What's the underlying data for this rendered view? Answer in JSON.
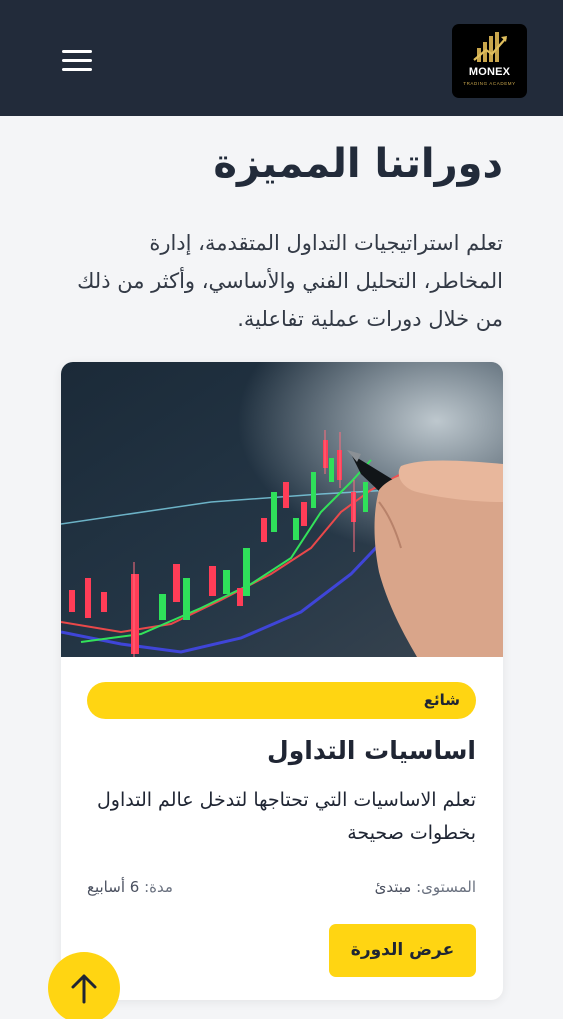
{
  "header": {
    "menu_icon": "hamburger-icon",
    "logo": {
      "name": "MONEX",
      "subtitle": "TRADING ACADEMY"
    }
  },
  "section": {
    "title": "دوراتنا المميزة",
    "description": "تعلم استراتيجيات التداول المتقدمة، إدارة المخاطر، التحليل الفني والأساسي، وأكثر من ذلك من خلال دورات عملية تفاعلية."
  },
  "course": {
    "image": "trading-candlestick-chart-photo",
    "badge": "شائع",
    "title": "اساسيات التداول",
    "description": "تعلم الاساسيات التي تحتاجها لتدخل عالم التداول بخطوات صحيحة",
    "level_label": "المستوى:",
    "level_value": "مبتدئ",
    "duration_label": "مدة:",
    "duration_value": "6 أسابيع",
    "cta": "عرض الدورة"
  },
  "scroll_top_icon": "arrow-up-icon",
  "colors": {
    "header_bg": "#222b3a",
    "accent": "#ffd512",
    "page_bg": "#f4f5f7",
    "text_dark": "#1f2533"
  }
}
